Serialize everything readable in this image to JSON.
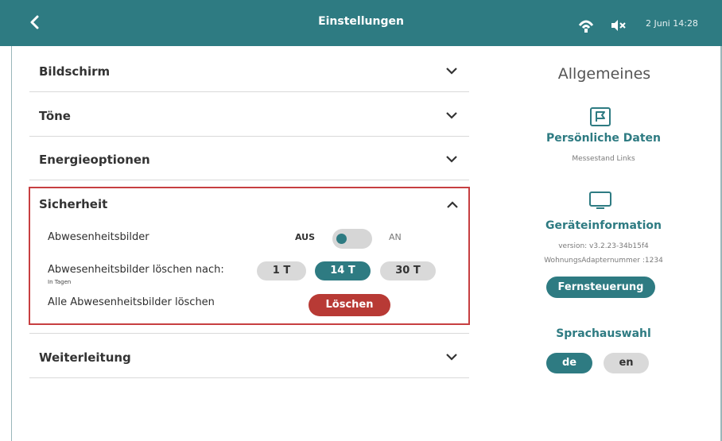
{
  "header": {
    "title": "Einstellungen",
    "datetime": "2 Juni 14:28"
  },
  "sections": {
    "bildschirm": "Bildschirm",
    "toene": "Töne",
    "energie": "Energieoptionen",
    "sicherheit": "Sicherheit",
    "weiterleitung": "Weiterleitung"
  },
  "security": {
    "away_images_label": "Abwesenheitsbilder",
    "toggle_off": "AUS",
    "toggle_on": "AN",
    "toggle_state": "off",
    "delete_after_label": "Abwesenheitsbilder löschen nach:",
    "delete_after_hint": "In Tagen",
    "options": [
      "1 T",
      "14 T",
      "30 T"
    ],
    "selected_option": "14 T",
    "delete_all_label": "Alle Abwesenheitsbilder löschen",
    "delete_button": "Löschen"
  },
  "general": {
    "title": "Allgemeines",
    "personal_title": "Persönliche Daten",
    "personal_sub": "Messestand Links",
    "device_title": "Geräteinformation",
    "version": "version: v3.2.23-34b15f4",
    "adapter": "WohnungsAdapternummer :1234",
    "remote_button": "Fernsteuerung",
    "language_title": "Sprachauswahl",
    "lang_de": "de",
    "lang_en": "en",
    "selected_lang": "de"
  },
  "colors": {
    "accent": "#2e7b82",
    "danger": "#b83a35",
    "highlight_border": "#c73f41"
  }
}
